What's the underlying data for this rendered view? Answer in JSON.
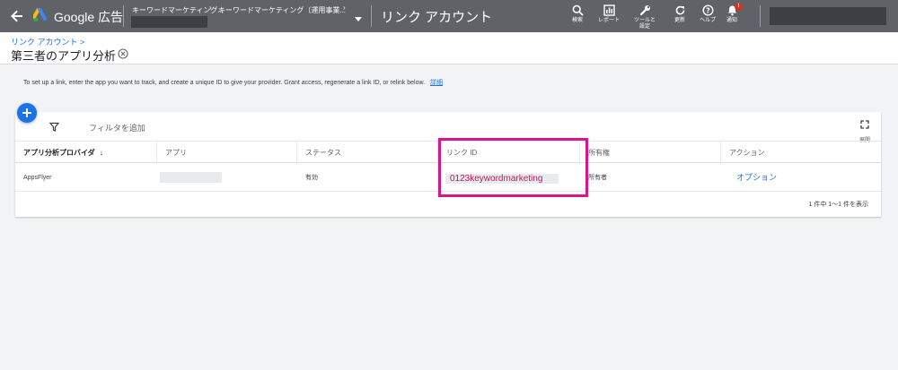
{
  "topbar": {
    "brand": "Google 広告",
    "crumb1": "キーワードマーケティング...",
    "crumb2": "キーワードマーケティング（運用事業...",
    "account_title": "リンク アカウント",
    "tools": [
      {
        "icon": "search-icon",
        "label": "検索"
      },
      {
        "icon": "report-icon",
        "label": "レポート"
      },
      {
        "icon": "wrench-icon",
        "label": "ツールと\n設定"
      },
      {
        "icon": "refresh-icon",
        "label": "更新"
      },
      {
        "icon": "help-icon",
        "label": "ヘルプ"
      },
      {
        "icon": "bell-icon",
        "label": "通知",
        "badge": "!"
      }
    ]
  },
  "header": {
    "breadcrumb": "リンク アカウント >",
    "title": "第三者のアプリ分析"
  },
  "info": {
    "text": "To set up a link, enter the app you want to track, and create a unique ID to give your provider. Grant access, regenerate a link ID, or relink below.",
    "link": "詳細"
  },
  "filter": {
    "label": "フィルタを追加"
  },
  "expand": {
    "label": "展開"
  },
  "table": {
    "columns": [
      "アプリ分析プロバイダ",
      "アプリ",
      "ステータス",
      "リンク ID",
      "所有権",
      "アクション"
    ],
    "rows": [
      {
        "provider": "AppsFlyer",
        "app": "",
        "status": "有効",
        "link_id": "0123keywordmarketing",
        "ownership": "所有者",
        "action": "オプション"
      }
    ]
  },
  "pager": "1 件中 1〜1 件を表示",
  "colors": {
    "topbar": "#5f6368",
    "accent": "#1a73e8",
    "highlight": "#d6168a"
  }
}
